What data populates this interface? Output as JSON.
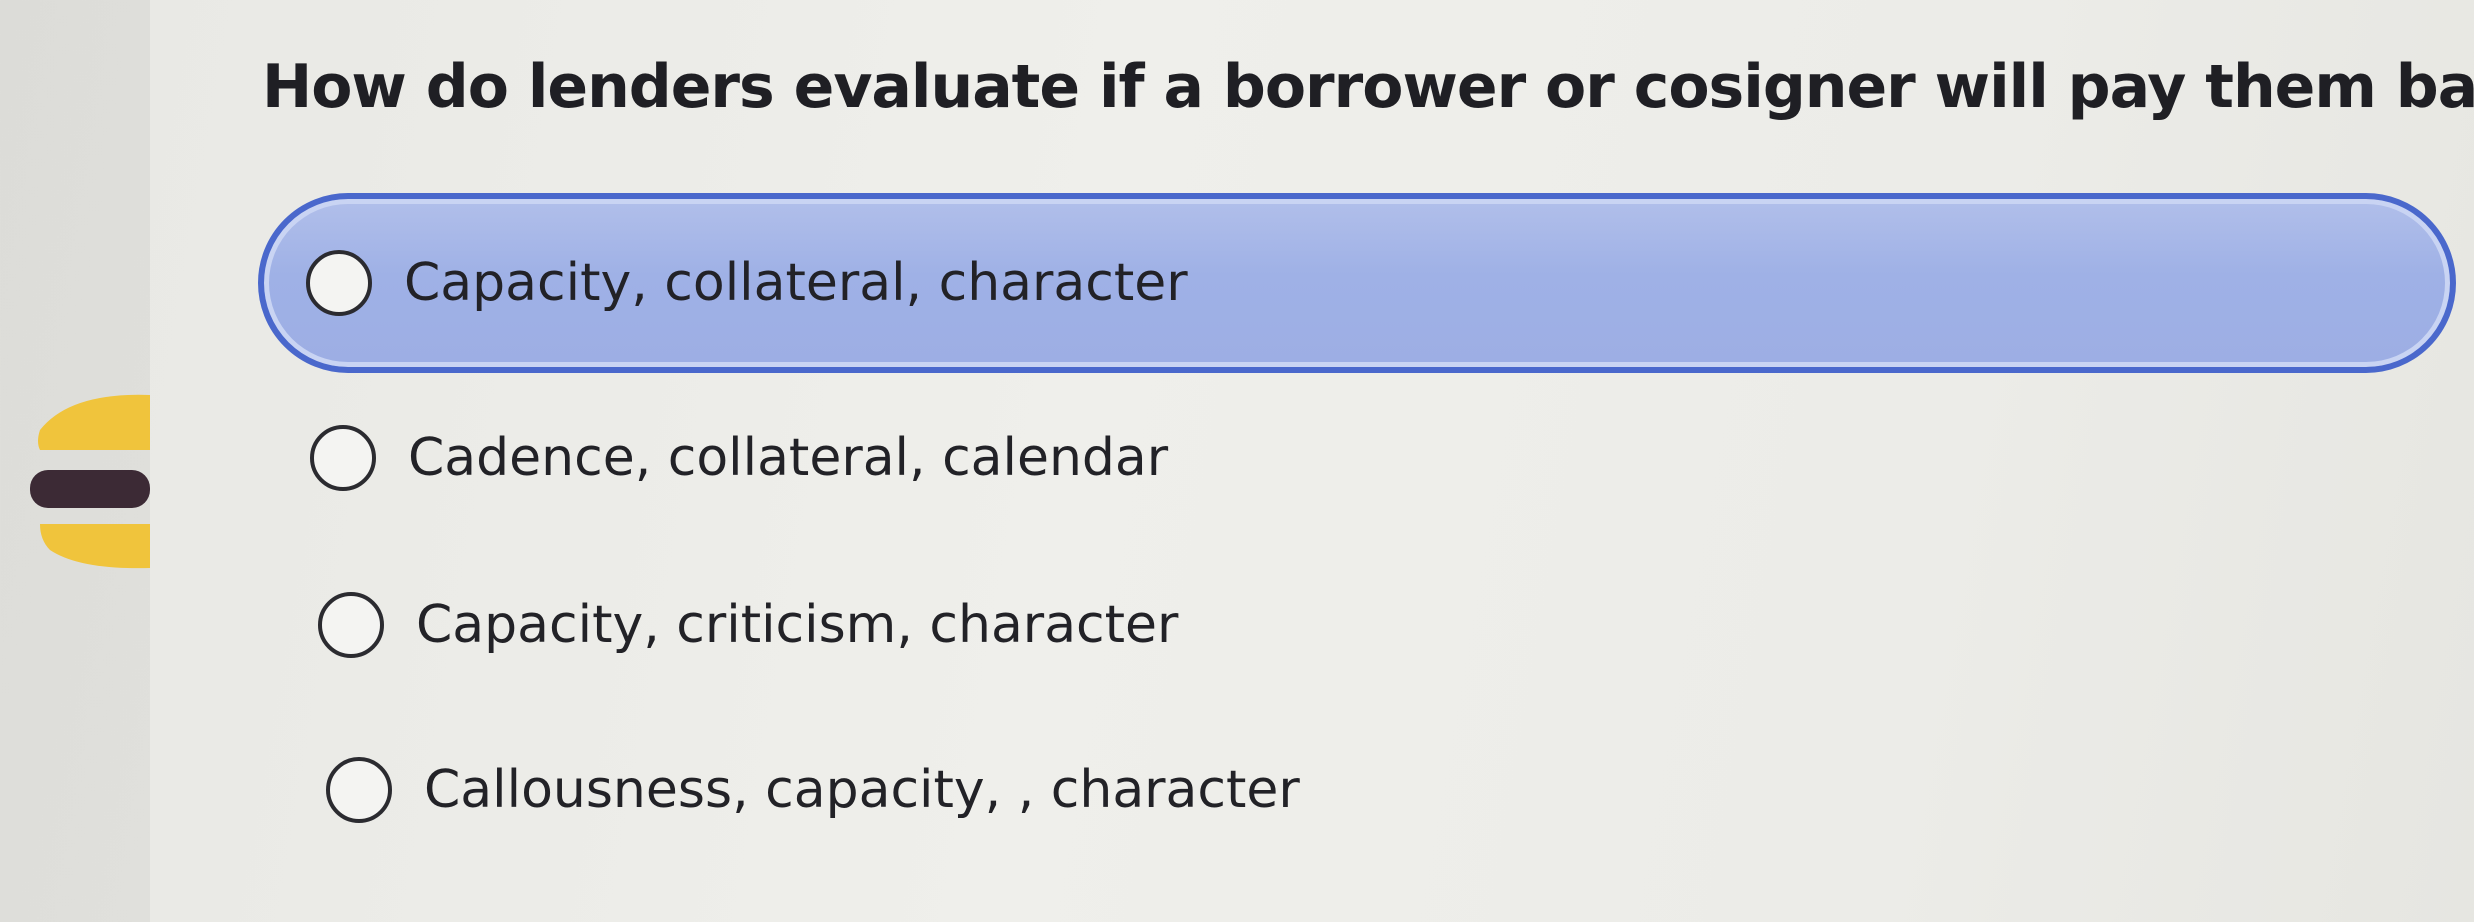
{
  "question": {
    "text": "How do lenders evaluate if a borrower or cosigner will pay them back?"
  },
  "options": [
    {
      "label": "Capacity, collateral, character",
      "selected": true
    },
    {
      "label": "Cadence, collateral, calendar",
      "selected": false
    },
    {
      "label": "Capacity, criticism, character",
      "selected": false
    },
    {
      "label": "Callousness, capacity, , character",
      "selected": false
    }
  ],
  "colors": {
    "selected_fill": "#9fb1e6",
    "selected_border": "#4a68cc",
    "text": "#222227",
    "logo_yellow": "#f0c43c",
    "logo_dark": "#3c2a35"
  },
  "logo": {
    "icon": "burger-logo-icon"
  }
}
